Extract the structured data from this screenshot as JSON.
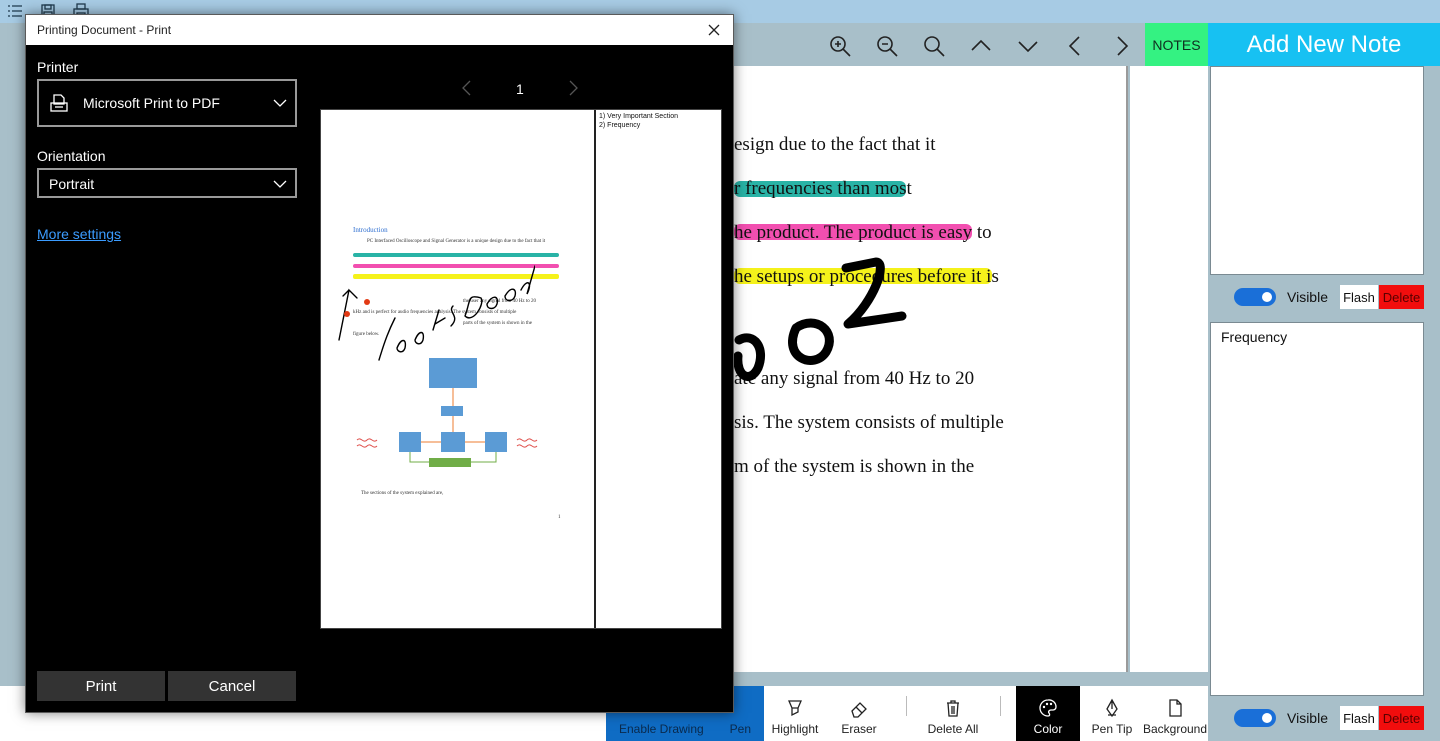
{
  "app": {
    "notes_tab": "NOTES",
    "add_note_label": "Add New Note",
    "document_lines": [
      "esign due to the fact that it",
      "r frequencies than most",
      "he product. The product is easy to",
      "he setups or procedures before it is",
      "ate any signal from 40 Hz to 20",
      "sis. The system consists of multiple",
      "m of the system is shown in the"
    ],
    "ink_text": "looks good",
    "highlight_colors": {
      "teal": "#29b3a6",
      "pink": "#f24fb0",
      "yellow": "#f5f21b"
    }
  },
  "notes": [
    {
      "text": "",
      "visible_label": "Visible",
      "flash_label": "Flash",
      "delete_label": "Delete"
    },
    {
      "text": "Frequency",
      "visible_label": "Visible",
      "flash_label": "Flash",
      "delete_label": "Delete"
    }
  ],
  "toolbar": {
    "enable_drawing": "Enable Drawing",
    "pen": "Pen",
    "highlight": "Highlight",
    "eraser": "Eraser",
    "delete_all": "Delete All",
    "color": "Color",
    "pen_tip": "Pen Tip",
    "background": "Background"
  },
  "print_dialog": {
    "title": "Printing Document - Print",
    "printer_label": "Printer",
    "printer_value": "Microsoft Print to PDF",
    "orientation_label": "Orientation",
    "orientation_value": "Portrait",
    "more_settings": "More settings",
    "page_number": "1",
    "print_button": "Print",
    "cancel_button": "Cancel",
    "preview": {
      "notes_list": [
        "1) Very Important Section",
        "2) Frequency"
      ],
      "heading": "Introduction",
      "paragraph": [
        "PC Interfaced Oscilloscope and Signal Generator is a unique design due to the fact that it",
        "the user any signal from 40 Hz to 20",
        "kHz and is perfect for audio frequencies analysis. The system consists of multiple",
        "parts of the system is shown in the",
        "figure below."
      ],
      "caption": "The sections of the system explained are,",
      "page_footer": "1"
    }
  },
  "colors": {
    "accent_blue": "#17c1f2",
    "notes_green": "#34f282",
    "delete_red": "#f20d0d",
    "toggle_blue": "#1a6fd8"
  }
}
